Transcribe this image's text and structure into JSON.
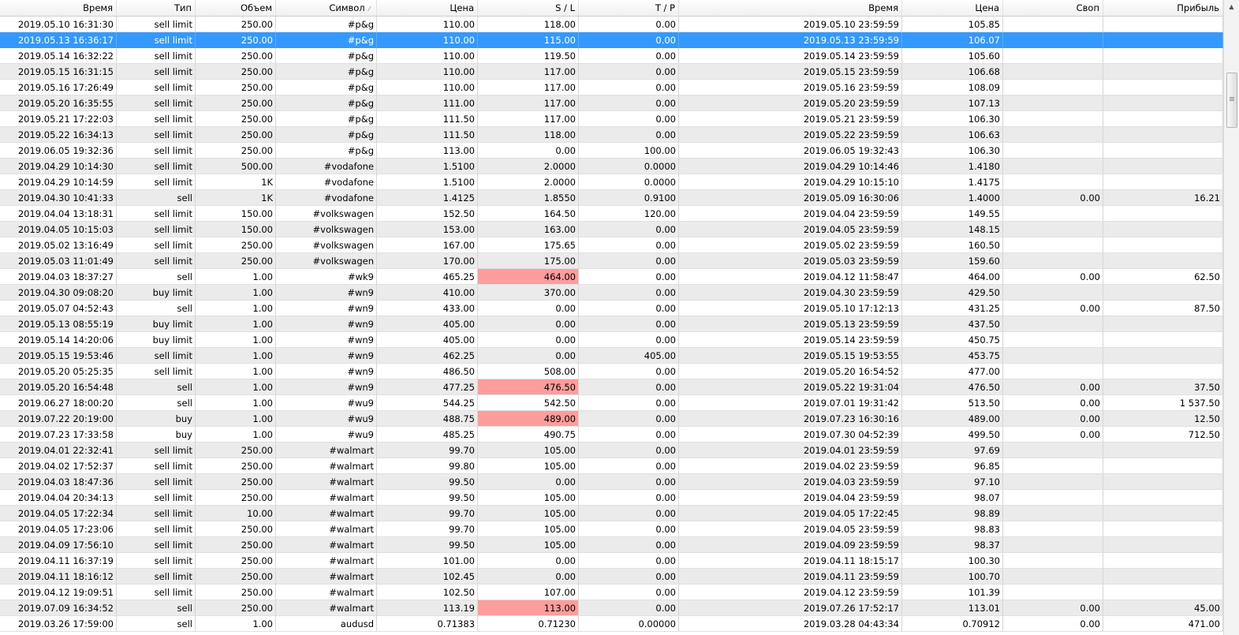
{
  "header": {
    "columns": [
      "Время",
      "Тип",
      "Объем",
      "Символ",
      "Цена",
      "S / L",
      "T / P",
      "Время",
      "Цена",
      "Своп",
      "Прибыль"
    ],
    "sort_indicator": "⁄"
  },
  "selected_row_index": 1,
  "highlight_color": "#ff9c9c",
  "selection_color": "#3399ff",
  "rows": [
    {
      "time": "2019.05.10 16:31:30",
      "type": "sell limit",
      "volume": "250.00",
      "symbol": "#p&g",
      "price": "110.00",
      "sl": "118.00",
      "tp": "0.00",
      "close_time": "2019.05.10 23:59:59",
      "close_price": "105.85",
      "swap": "",
      "profit": ""
    },
    {
      "time": "2019.05.13 16:36:17",
      "type": "sell limit",
      "volume": "250.00",
      "symbol": "#p&g",
      "price": "110.00",
      "sl": "115.00",
      "tp": "0.00",
      "close_time": "2019.05.13 23:59:59",
      "close_price": "106.07",
      "swap": "",
      "profit": ""
    },
    {
      "time": "2019.05.14 16:32:22",
      "type": "sell limit",
      "volume": "250.00",
      "symbol": "#p&g",
      "price": "110.00",
      "sl": "119.50",
      "tp": "0.00",
      "close_time": "2019.05.14 23:59:59",
      "close_price": "105.60",
      "swap": "",
      "profit": ""
    },
    {
      "time": "2019.05.15 16:31:15",
      "type": "sell limit",
      "volume": "250.00",
      "symbol": "#p&g",
      "price": "110.00",
      "sl": "117.00",
      "tp": "0.00",
      "close_time": "2019.05.15 23:59:59",
      "close_price": "106.68",
      "swap": "",
      "profit": ""
    },
    {
      "time": "2019.05.16 17:26:49",
      "type": "sell limit",
      "volume": "250.00",
      "symbol": "#p&g",
      "price": "110.00",
      "sl": "117.00",
      "tp": "0.00",
      "close_time": "2019.05.16 23:59:59",
      "close_price": "108.09",
      "swap": "",
      "profit": ""
    },
    {
      "time": "2019.05.20 16:35:55",
      "type": "sell limit",
      "volume": "250.00",
      "symbol": "#p&g",
      "price": "111.00",
      "sl": "117.00",
      "tp": "0.00",
      "close_time": "2019.05.20 23:59:59",
      "close_price": "107.13",
      "swap": "",
      "profit": ""
    },
    {
      "time": "2019.05.21 17:22:03",
      "type": "sell limit",
      "volume": "250.00",
      "symbol": "#p&g",
      "price": "111.50",
      "sl": "117.00",
      "tp": "0.00",
      "close_time": "2019.05.21 23:59:59",
      "close_price": "106.30",
      "swap": "",
      "profit": ""
    },
    {
      "time": "2019.05.22 16:34:13",
      "type": "sell limit",
      "volume": "250.00",
      "symbol": "#p&g",
      "price": "111.50",
      "sl": "118.00",
      "tp": "0.00",
      "close_time": "2019.05.22 23:59:59",
      "close_price": "106.63",
      "swap": "",
      "profit": ""
    },
    {
      "time": "2019.06.05 19:32:36",
      "type": "sell limit",
      "volume": "250.00",
      "symbol": "#p&g",
      "price": "113.00",
      "sl": "0.00",
      "tp": "100.00",
      "close_time": "2019.06.05 19:32:43",
      "close_price": "106.30",
      "swap": "",
      "profit": ""
    },
    {
      "time": "2019.04.29 10:14:30",
      "type": "sell limit",
      "volume": "500.00",
      "symbol": "#vodafone",
      "price": "1.5100",
      "sl": "2.0000",
      "tp": "0.0000",
      "close_time": "2019.04.29 10:14:46",
      "close_price": "1.4180",
      "swap": "",
      "profit": ""
    },
    {
      "time": "2019.04.29 10:14:59",
      "type": "sell limit",
      "volume": "1K",
      "symbol": "#vodafone",
      "price": "1.5100",
      "sl": "2.0000",
      "tp": "0.0000",
      "close_time": "2019.04.29 10:15:10",
      "close_price": "1.4175",
      "swap": "",
      "profit": ""
    },
    {
      "time": "2019.04.30 10:41:33",
      "type": "sell",
      "volume": "1K",
      "symbol": "#vodafone",
      "price": "1.4125",
      "sl": "1.8550",
      "tp": "0.9100",
      "close_time": "2019.05.09 16:30:06",
      "close_price": "1.4000",
      "swap": "0.00",
      "profit": "16.21"
    },
    {
      "time": "2019.04.04 13:18:31",
      "type": "sell limit",
      "volume": "150.00",
      "symbol": "#volkswagen",
      "price": "152.50",
      "sl": "164.50",
      "tp": "120.00",
      "close_time": "2019.04.04 23:59:59",
      "close_price": "149.55",
      "swap": "",
      "profit": ""
    },
    {
      "time": "2019.04.05 10:15:03",
      "type": "sell limit",
      "volume": "150.00",
      "symbol": "#volkswagen",
      "price": "153.00",
      "sl": "163.00",
      "tp": "0.00",
      "close_time": "2019.04.05 23:59:59",
      "close_price": "148.15",
      "swap": "",
      "profit": ""
    },
    {
      "time": "2019.05.02 13:16:49",
      "type": "sell limit",
      "volume": "250.00",
      "symbol": "#volkswagen",
      "price": "167.00",
      "sl": "175.65",
      "tp": "0.00",
      "close_time": "2019.05.02 23:59:59",
      "close_price": "160.50",
      "swap": "",
      "profit": ""
    },
    {
      "time": "2019.05.03 11:01:49",
      "type": "sell limit",
      "volume": "250.00",
      "symbol": "#volkswagen",
      "price": "170.00",
      "sl": "175.00",
      "tp": "0.00",
      "close_time": "2019.05.03 23:59:59",
      "close_price": "159.60",
      "swap": "",
      "profit": ""
    },
    {
      "time": "2019.04.03 18:37:27",
      "type": "sell",
      "volume": "1.00",
      "symbol": "#wk9",
      "price": "465.25",
      "sl": "464.00",
      "sl_hit": true,
      "tp": "0.00",
      "close_time": "2019.04.12 11:58:47",
      "close_price": "464.00",
      "swap": "0.00",
      "profit": "62.50"
    },
    {
      "time": "2019.04.30 09:08:20",
      "type": "buy limit",
      "volume": "1.00",
      "symbol": "#wn9",
      "price": "410.00",
      "sl": "370.00",
      "tp": "0.00",
      "close_time": "2019.04.30 23:59:59",
      "close_price": "429.50",
      "swap": "",
      "profit": ""
    },
    {
      "time": "2019.05.07 04:52:43",
      "type": "sell",
      "volume": "1.00",
      "symbol": "#wn9",
      "price": "433.00",
      "sl": "0.00",
      "tp": "0.00",
      "close_time": "2019.05.10 17:12:13",
      "close_price": "431.25",
      "swap": "0.00",
      "profit": "87.50"
    },
    {
      "time": "2019.05.13 08:55:19",
      "type": "buy limit",
      "volume": "1.00",
      "symbol": "#wn9",
      "price": "405.00",
      "sl": "0.00",
      "tp": "0.00",
      "close_time": "2019.05.13 23:59:59",
      "close_price": "437.50",
      "swap": "",
      "profit": ""
    },
    {
      "time": "2019.05.14 14:20:06",
      "type": "buy limit",
      "volume": "1.00",
      "symbol": "#wn9",
      "price": "405.00",
      "sl": "0.00",
      "tp": "0.00",
      "close_time": "2019.05.14 23:59:59",
      "close_price": "450.75",
      "swap": "",
      "profit": ""
    },
    {
      "time": "2019.05.15 19:53:46",
      "type": "sell limit",
      "volume": "1.00",
      "symbol": "#wn9",
      "price": "462.25",
      "sl": "0.00",
      "tp": "405.00",
      "close_time": "2019.05.15 19:53:55",
      "close_price": "453.75",
      "swap": "",
      "profit": ""
    },
    {
      "time": "2019.05.20 05:25:35",
      "type": "sell limit",
      "volume": "1.00",
      "symbol": "#wn9",
      "price": "486.50",
      "sl": "508.00",
      "tp": "0.00",
      "close_time": "2019.05.20 16:54:52",
      "close_price": "477.00",
      "swap": "",
      "profit": ""
    },
    {
      "time": "2019.05.20 16:54:48",
      "type": "sell",
      "volume": "1.00",
      "symbol": "#wn9",
      "price": "477.25",
      "sl": "476.50",
      "sl_hit": true,
      "tp": "0.00",
      "close_time": "2019.05.22 19:31:04",
      "close_price": "476.50",
      "swap": "0.00",
      "profit": "37.50"
    },
    {
      "time": "2019.06.27 18:00:20",
      "type": "sell",
      "volume": "1.00",
      "symbol": "#wu9",
      "price": "544.25",
      "sl": "542.50",
      "tp": "0.00",
      "close_time": "2019.07.01 19:31:42",
      "close_price": "513.50",
      "swap": "0.00",
      "profit": "1 537.50"
    },
    {
      "time": "2019.07.22 20:19:00",
      "type": "buy",
      "volume": "1.00",
      "symbol": "#wu9",
      "price": "488.75",
      "sl": "489.00",
      "sl_hit": true,
      "tp": "0.00",
      "close_time": "2019.07.23 16:30:16",
      "close_price": "489.00",
      "swap": "0.00",
      "profit": "12.50"
    },
    {
      "time": "2019.07.23 17:33:58",
      "type": "buy",
      "volume": "1.00",
      "symbol": "#wu9",
      "price": "485.25",
      "sl": "490.75",
      "tp": "0.00",
      "close_time": "2019.07.30 04:52:39",
      "close_price": "499.50",
      "swap": "0.00",
      "profit": "712.50"
    },
    {
      "time": "2019.04.01 22:32:41",
      "type": "sell limit",
      "volume": "250.00",
      "symbol": "#walmart",
      "price": "99.70",
      "sl": "105.00",
      "tp": "0.00",
      "close_time": "2019.04.01 23:59:59",
      "close_price": "97.69",
      "swap": "",
      "profit": ""
    },
    {
      "time": "2019.04.02 17:52:37",
      "type": "sell limit",
      "volume": "250.00",
      "symbol": "#walmart",
      "price": "99.80",
      "sl": "105.00",
      "tp": "0.00",
      "close_time": "2019.04.02 23:59:59",
      "close_price": "96.85",
      "swap": "",
      "profit": ""
    },
    {
      "time": "2019.04.03 18:47:36",
      "type": "sell limit",
      "volume": "250.00",
      "symbol": "#walmart",
      "price": "99.50",
      "sl": "0.00",
      "tp": "0.00",
      "close_time": "2019.04.03 23:59:59",
      "close_price": "97.10",
      "swap": "",
      "profit": ""
    },
    {
      "time": "2019.04.04 20:34:13",
      "type": "sell limit",
      "volume": "250.00",
      "symbol": "#walmart",
      "price": "99.50",
      "sl": "105.00",
      "tp": "0.00",
      "close_time": "2019.04.04 23:59:59",
      "close_price": "98.07",
      "swap": "",
      "profit": ""
    },
    {
      "time": "2019.04.05 17:22:34",
      "type": "sell limit",
      "volume": "10.00",
      "symbol": "#walmart",
      "price": "99.70",
      "sl": "105.00",
      "tp": "0.00",
      "close_time": "2019.04.05 17:22:45",
      "close_price": "98.89",
      "swap": "",
      "profit": ""
    },
    {
      "time": "2019.04.05 17:23:06",
      "type": "sell limit",
      "volume": "250.00",
      "symbol": "#walmart",
      "price": "99.70",
      "sl": "105.00",
      "tp": "0.00",
      "close_time": "2019.04.05 23:59:59",
      "close_price": "98.83",
      "swap": "",
      "profit": ""
    },
    {
      "time": "2019.04.09 17:56:10",
      "type": "sell limit",
      "volume": "250.00",
      "symbol": "#walmart",
      "price": "99.50",
      "sl": "105.00",
      "tp": "0.00",
      "close_time": "2019.04.09 23:59:59",
      "close_price": "98.37",
      "swap": "",
      "profit": ""
    },
    {
      "time": "2019.04.11 16:37:19",
      "type": "sell limit",
      "volume": "250.00",
      "symbol": "#walmart",
      "price": "101.00",
      "sl": "0.00",
      "tp": "0.00",
      "close_time": "2019.04.11 18:15:17",
      "close_price": "100.30",
      "swap": "",
      "profit": ""
    },
    {
      "time": "2019.04.11 18:16:12",
      "type": "sell limit",
      "volume": "250.00",
      "symbol": "#walmart",
      "price": "102.45",
      "sl": "0.00",
      "tp": "0.00",
      "close_time": "2019.04.11 23:59:59",
      "close_price": "100.70",
      "swap": "",
      "profit": ""
    },
    {
      "time": "2019.04.12 19:09:51",
      "type": "sell limit",
      "volume": "250.00",
      "symbol": "#walmart",
      "price": "102.50",
      "sl": "107.00",
      "tp": "0.00",
      "close_time": "2019.04.12 23:59:59",
      "close_price": "101.39",
      "swap": "",
      "profit": ""
    },
    {
      "time": "2019.07.09 16:34:52",
      "type": "sell",
      "volume": "250.00",
      "symbol": "#walmart",
      "price": "113.19",
      "sl": "113.00",
      "sl_hit": true,
      "tp": "0.00",
      "close_time": "2019.07.26 17:52:17",
      "close_price": "113.01",
      "swap": "0.00",
      "profit": "45.00"
    },
    {
      "time": "2019.03.26 17:59:00",
      "type": "sell",
      "volume": "1.00",
      "symbol": "audusd",
      "price": "0.71383",
      "sl": "0.71230",
      "tp": "0.00000",
      "close_time": "2019.03.28 04:43:34",
      "close_price": "0.70912",
      "swap": "0.00",
      "profit": "471.00"
    }
  ]
}
